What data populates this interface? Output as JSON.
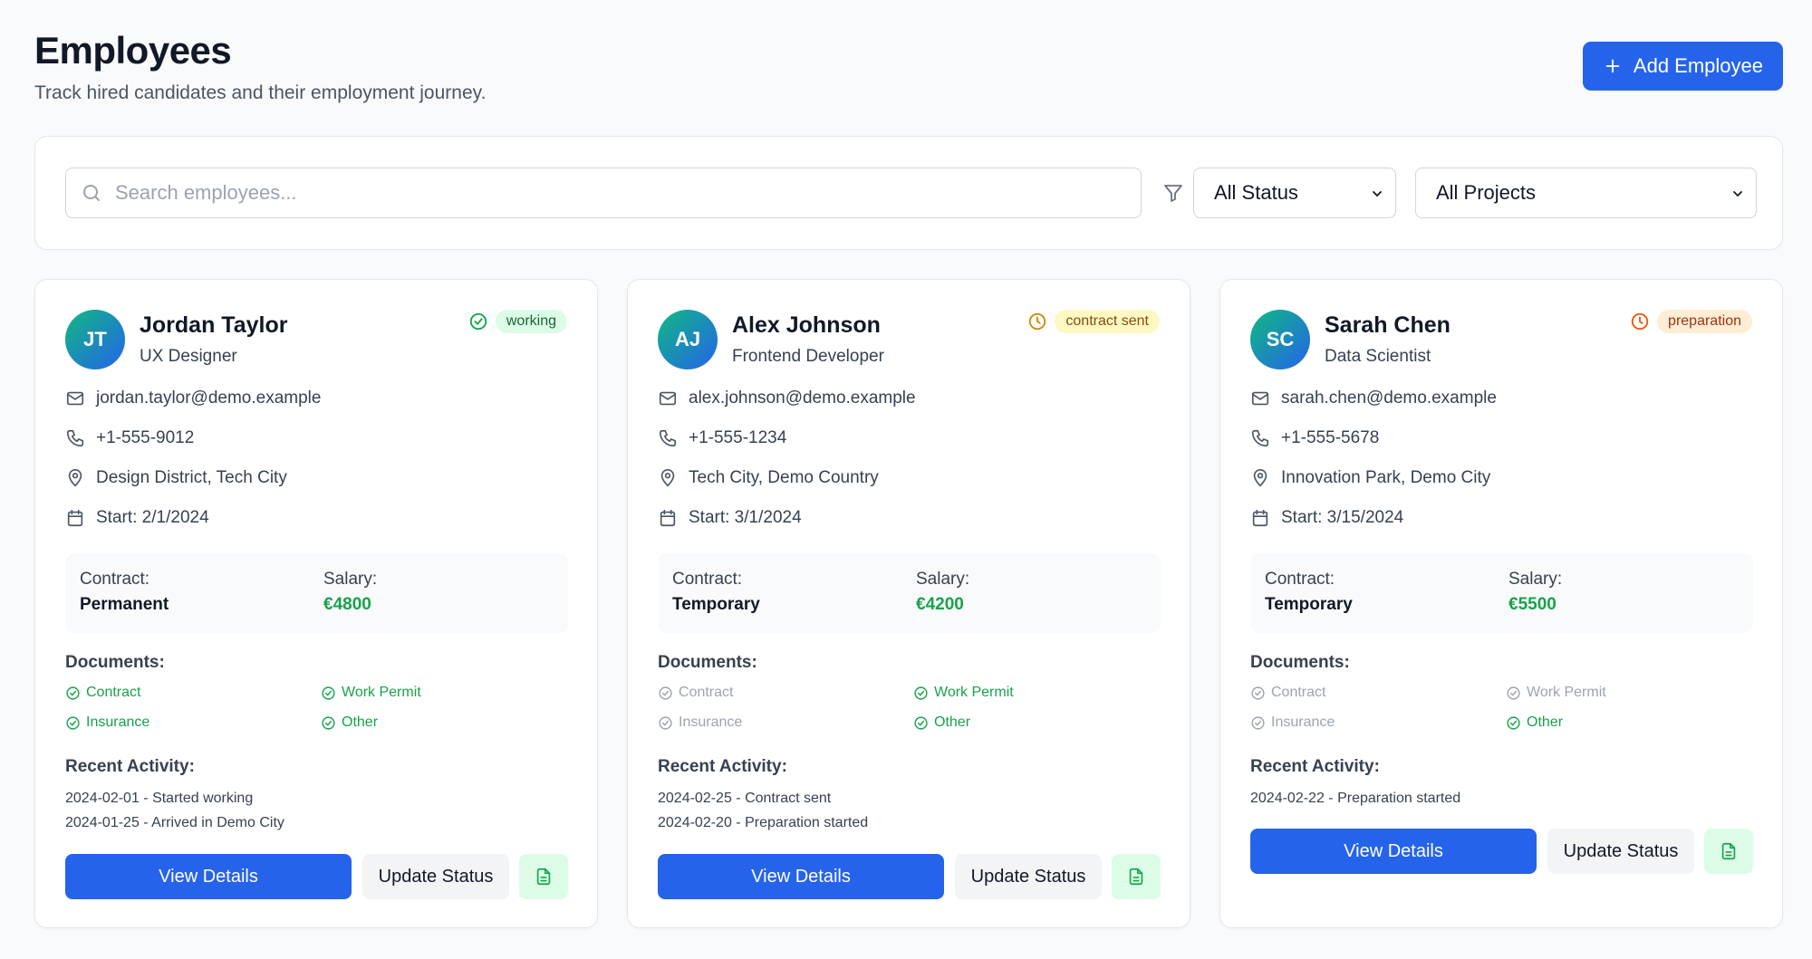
{
  "header": {
    "title": "Employees",
    "subtitle": "Track hired candidates and their employment journey.",
    "add_button_label": "Add Employee"
  },
  "filters": {
    "search_placeholder": "Search employees...",
    "status_selected": "All Status",
    "project_selected": "All Projects"
  },
  "labels": {
    "contract": "Contract:",
    "salary": "Salary:",
    "documents": "Documents:",
    "recent_activity": "Recent Activity:",
    "view_details": "View Details",
    "update_status": "Update Status",
    "doc_contract": "Contract",
    "doc_work_permit": "Work Permit",
    "doc_insurance": "Insurance",
    "doc_other": "Other"
  },
  "employees": [
    {
      "initials": "JT",
      "name": "Jordan Taylor",
      "role": "UX Designer",
      "status": "working",
      "email": "jordan.taylor@demo.example",
      "phone": "+1-555-9012",
      "location": "Design District, Tech City",
      "start": "Start: 2/1/2024",
      "contract_type": "Permanent",
      "salary": "€4800",
      "activity": [
        "2024-02-01 - Started working",
        "2024-01-25 - Arrived in Demo City"
      ]
    },
    {
      "initials": "AJ",
      "name": "Alex Johnson",
      "role": "Frontend Developer",
      "status": "contract sent",
      "email": "alex.johnson@demo.example",
      "phone": "+1-555-1234",
      "location": "Tech City, Demo Country",
      "start": "Start: 3/1/2024",
      "contract_type": "Temporary",
      "salary": "€4200",
      "activity": [
        "2024-02-25 - Contract sent",
        "2024-02-20 - Preparation started"
      ]
    },
    {
      "initials": "SC",
      "name": "Sarah Chen",
      "role": "Data Scientist",
      "status": "preparation",
      "email": "sarah.chen@demo.example",
      "phone": "+1-555-5678",
      "location": "Innovation Park, Demo City",
      "start": "Start: 3/15/2024",
      "contract_type": "Temporary",
      "salary": "€5500",
      "activity": [
        "2024-02-22 - Preparation started"
      ]
    }
  ],
  "colors": {
    "primary": "#2563eb",
    "success": "#16a34a",
    "muted": "#9ca3af",
    "warning": "#ca8a04",
    "orange": "#ea580c"
  }
}
